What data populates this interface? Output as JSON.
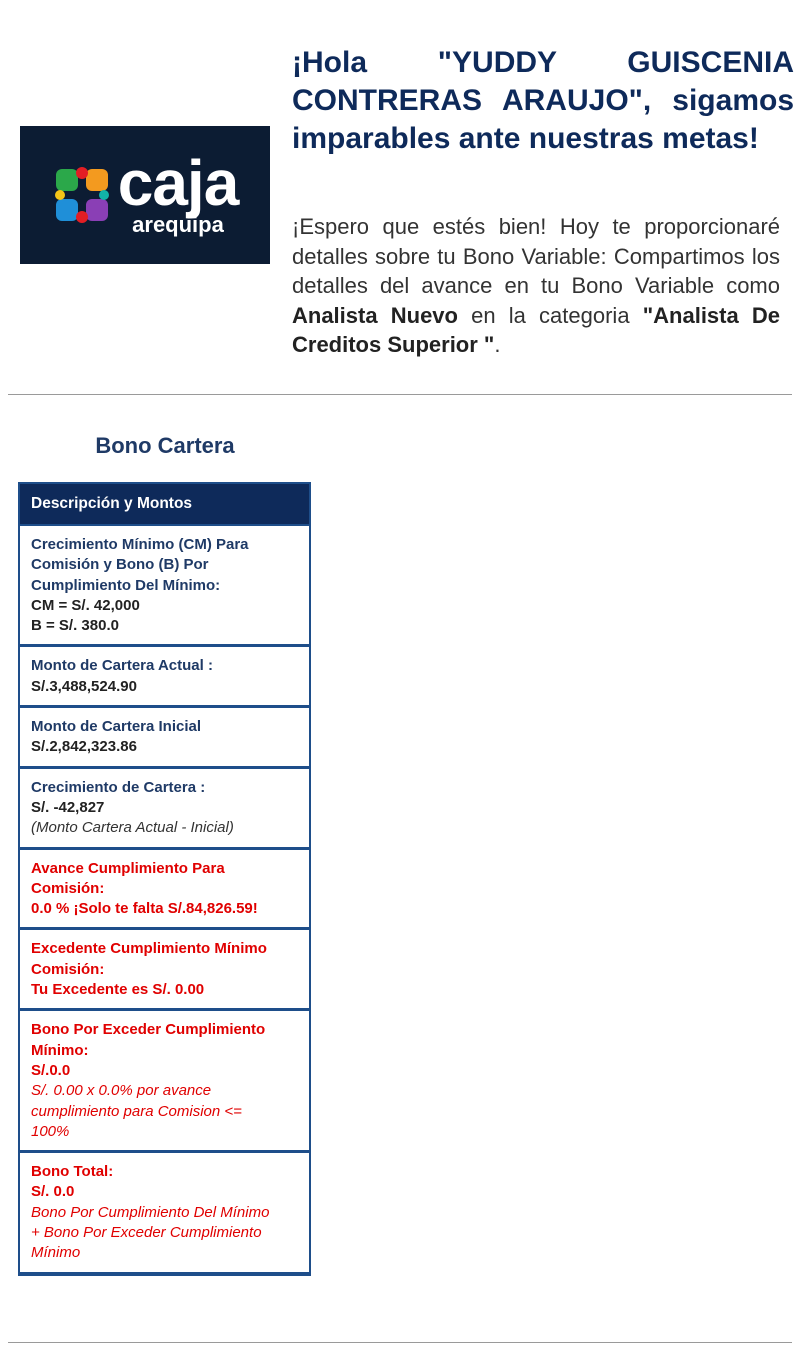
{
  "brand": {
    "name": "caja",
    "sub": "arequipa",
    "colors": {
      "navy": "#0e2a5a",
      "logo_bg": "#0c1c33",
      "red": "#e00000",
      "border": "#1e4e8a"
    }
  },
  "header": {
    "headline": "¡Hola \"YUDDY GUISCENIA CONTRERAS ARAUJO\", sigamos imparables ante nuestras metas!",
    "intro_prefix": "¡Espero que estés bien! Hoy te proporcionaré detalles sobre tu Bono Variable: Compartimos los detalles del avance en tu Bono Variable como ",
    "role": "Analista Nuevo",
    "intro_mid": " en la categoria ",
    "category": "\"Analista De Creditos Superior \"",
    "intro_end": "."
  },
  "section": {
    "title": "Bono Cartera",
    "table_header": "Descripción y Montos",
    "rows": {
      "cm": {
        "label_1": "Crecimiento Mínimo (CM) Para",
        "label_2": "Comisión y Bono (B) Por",
        "label_3": "Cumplimiento Del Mínimo:",
        "cm_value": "CM = S/. 42,000",
        "b_value": "B = S/. 380.0"
      },
      "actual": {
        "label": "Monto de Cartera Actual :",
        "value": "S/.3,488,524.90"
      },
      "inicial": {
        "label": "Monto de Cartera Inicial",
        "value": "S/.2,842,323.86"
      },
      "crecimiento": {
        "label": "Crecimiento de Cartera :",
        "value": "S/. -42,827",
        "note": "(Monto Cartera Actual - Inicial)"
      },
      "avance": {
        "label_1": "Avance Cumplimiento Para",
        "label_2": "Comisión:",
        "value": "0.0 % ¡Solo te falta S/.84,826.59!"
      },
      "excedente": {
        "label_1": "Excedente Cumplimiento Mínimo",
        "label_2": "Comisión:",
        "value": "Tu Excedente es S/. 0.00"
      },
      "bono_exceder": {
        "label_1": "Bono Por Exceder Cumplimiento",
        "label_2": "Mínimo:",
        "value": "S/.0.0",
        "note_1": "S/. 0.00 x 0.0% por avance",
        "note_2": "cumplimiento para Comision <=",
        "note_3": "100%"
      },
      "bono_total": {
        "label": "Bono Total:",
        "value": "S/. 0.0",
        "note_1": "Bono Por Cumplimiento Del Mínimo",
        "note_2": "+ Bono Por Exceder Cumplimiento",
        "note_3": "Mínimo"
      }
    }
  }
}
